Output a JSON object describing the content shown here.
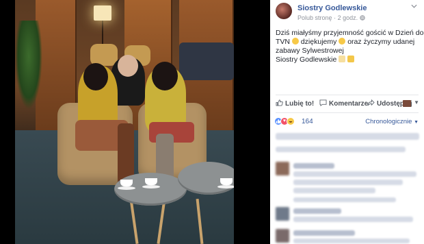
{
  "post": {
    "page_name": "Siostry Godlewskie",
    "meta_publisher": "Polub stronę",
    "meta_sep": "·",
    "meta_time": "2 godz.",
    "text_line1": "Dziś miałyśmy przyjemność gościć w Dzień dobry",
    "text_line2a": "TVN",
    "text_line2b": "dziękujemy",
    "text_line2c": "oraz życzymy udanej",
    "text_line3": "zabawy Sylwestrowej",
    "text_line4": "Siostry Godlewskie"
  },
  "actions": {
    "like": "Lubię to!",
    "comment": "Komentarze",
    "share": "Udostępnij"
  },
  "reactions": {
    "count": "164",
    "sort_label": "Chronologicznie"
  },
  "colors": {
    "link": "#365899",
    "like_blue": "#5890ff",
    "love_red": "#f25268",
    "haha_yellow": "#f7c948"
  }
}
